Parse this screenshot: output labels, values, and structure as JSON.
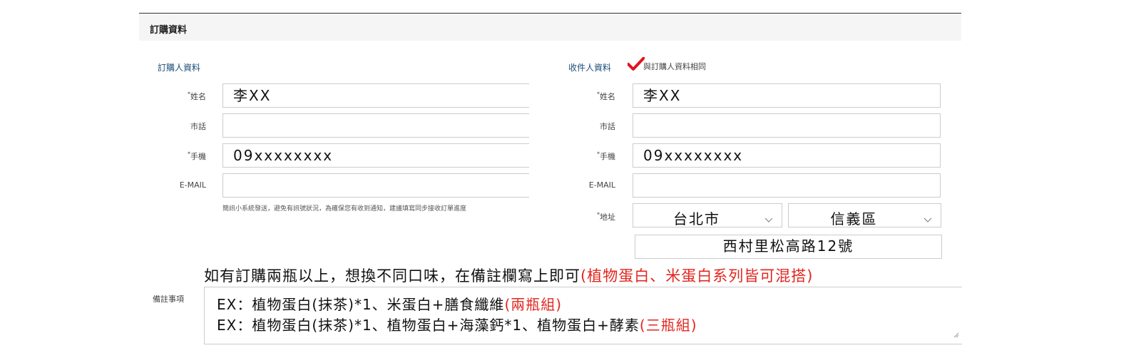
{
  "header": {
    "title": "訂購資料"
  },
  "orderer": {
    "section_label": "訂購人資料",
    "fields": [
      {
        "label": "姓名",
        "required": true,
        "value": "李XX"
      },
      {
        "label": "市話",
        "required": false,
        "value": ""
      },
      {
        "label": "手機",
        "required": true,
        "value": "09xxxxxxxx"
      },
      {
        "label": "E-MAIL",
        "required": false,
        "value": ""
      }
    ],
    "note": "簡訊小系統發送，避免有訊號狀況，為確保您有收到通知，建議填寫同步接收訂單進度"
  },
  "recipient": {
    "section_label": "收件人資料",
    "same_as_orderer": {
      "checked": true,
      "label": "與訂購人資料相同"
    },
    "fields": [
      {
        "label": "姓名",
        "required": true,
        "value": "李XX"
      },
      {
        "label": "市話",
        "required": false,
        "value": ""
      },
      {
        "label": "手機",
        "required": true,
        "value": "09xxxxxxxx"
      },
      {
        "label": "E-MAIL",
        "required": false,
        "value": ""
      }
    ],
    "address": {
      "label": "地址",
      "required": true,
      "city": "台北市",
      "district": "信義區",
      "street": "西村里松高路12號"
    }
  },
  "instruction": {
    "text": "如有訂購兩瓶以上，想換不同口味，在備註欄寫上即可",
    "highlight": "(植物蛋白、米蛋白系列皆可混搭)"
  },
  "remarks": {
    "label": "備註事項",
    "lines": [
      {
        "text": "EX：植物蛋白(抹茶)*1、米蛋白+膳食纖維",
        "highlight": "(兩瓶組)"
      },
      {
        "text": "EX：植物蛋白(抹茶)*1、植物蛋白+海藻鈣*1、植物蛋白+酵素",
        "highlight": "(三瓶組)"
      }
    ]
  },
  "colors": {
    "accent_red": "#e2261f",
    "label_blue": "#1a4f7a",
    "checkmark_red": "#e0141e"
  },
  "icons": {
    "checkmark": "checkmark-icon",
    "chevron": "chevron-down-icon",
    "resize": "resize-handle-icon"
  }
}
